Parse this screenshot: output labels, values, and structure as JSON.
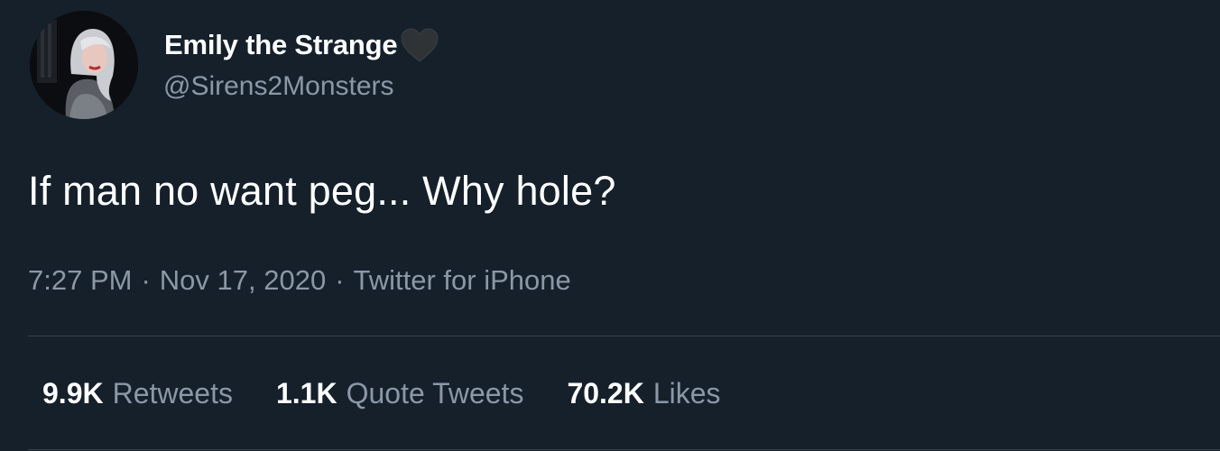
{
  "author": {
    "display_name": "Emily the Strange",
    "handle": "@Sirens2Monsters",
    "name_emoji_icon": "black-heart-icon"
  },
  "tweet": {
    "text": "If man no want peg... Why hole?",
    "time": "7:27 PM",
    "date": "Nov 17, 2020",
    "source": "Twitter for iPhone",
    "separator": "·"
  },
  "stats": [
    {
      "value": "9.9K",
      "label": "Retweets"
    },
    {
      "value": "1.1K",
      "label": "Quote Tweets"
    },
    {
      "value": "70.2K",
      "label": "Likes"
    }
  ],
  "colors": {
    "background": "#15202b",
    "primary_text": "#ffffff",
    "secondary_text": "#8b98a5",
    "divider": "#38444d"
  }
}
